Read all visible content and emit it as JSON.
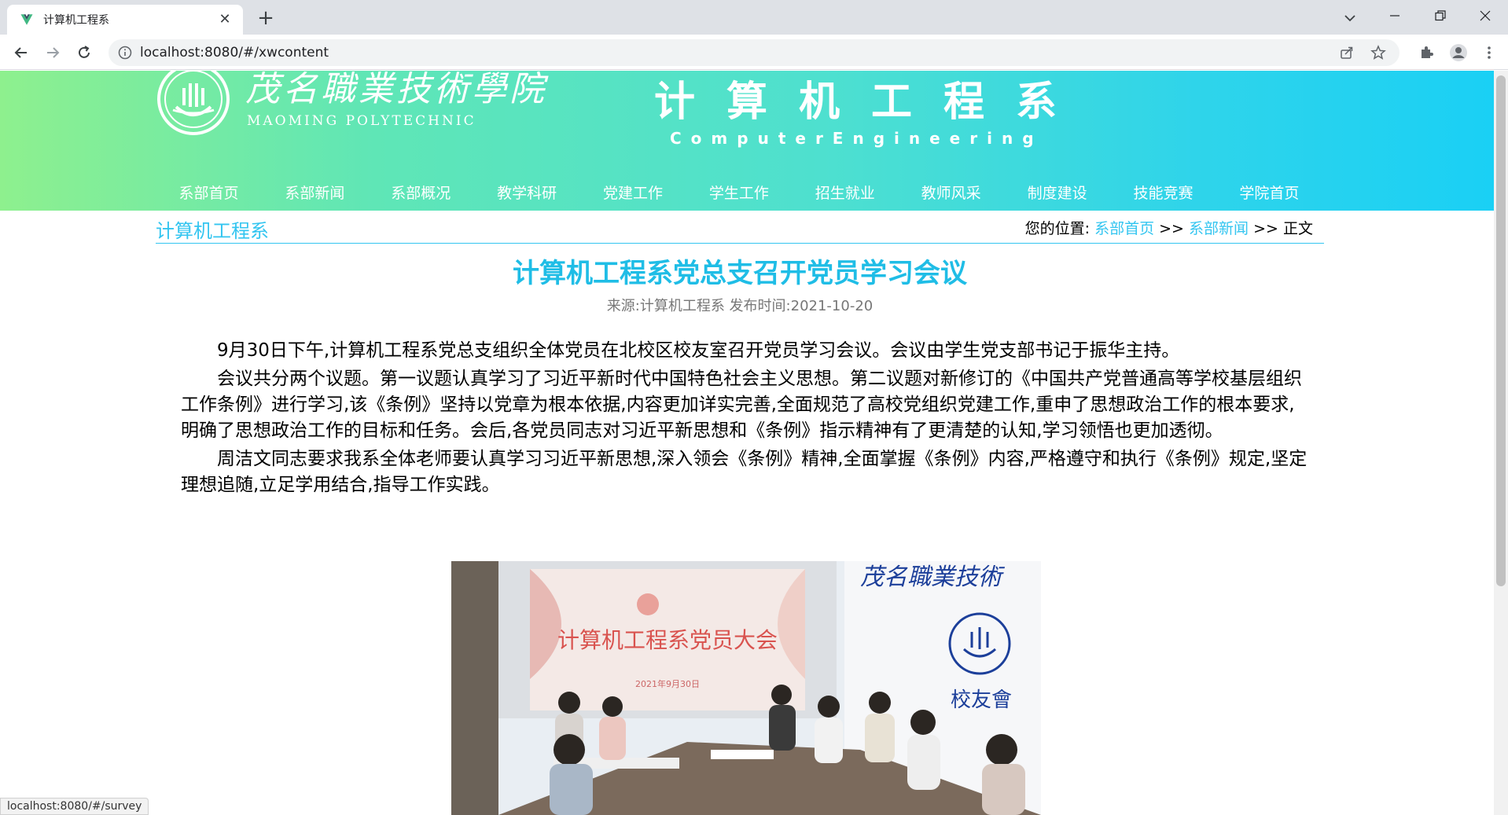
{
  "browser": {
    "tab_title": "计算机工程系",
    "url": "localhost:8080/#/xwcontent",
    "status_url": "localhost:8080/#/survey"
  },
  "header": {
    "school_name_cn": "茂名職業技術學院",
    "school_name_en": "MAOMING POLYTECHNIC",
    "dept_name_cn": "计算机工程系",
    "dept_name_en": "ComputerEngineering"
  },
  "nav": {
    "items": [
      "系部首页",
      "系部新闻",
      "系部概况",
      "教学科研",
      "党建工作",
      "学生工作",
      "招生就业",
      "教师风采",
      "制度建设",
      "技能竞赛",
      "学院首页"
    ]
  },
  "section": {
    "title": "计算机工程系",
    "breadcrumb_prefix": "您的位置:",
    "crumb_home": "系部首页",
    "crumb_sep1": ">>",
    "crumb_news": "系部新闻",
    "crumb_sep2": ">>",
    "crumb_current": "正文"
  },
  "article": {
    "title": "计算机工程系党总支召开党员学习会议",
    "meta": "来源:计算机工程系 发布时间:2021-10-20",
    "paragraphs": [
      "9月30日下午,计算机工程系党总支组织全体党员在北校区校友室召开党员学习会议。会议由学生党支部书记于振华主持。",
      "会议共分两个议题。第一议题认真学习了习近平新时代中国特色社会主义思想。第二议题对新修订的《中国共产党普通高等学校基层组织工作条例》进行学习,该《条例》坚持以党章为根本依据,内容更加详实完善,全面规范了高校党组织党建工作,重申了思想政治工作的根本要求,明确了思想政治工作的目标和任务。会后,各党员同志对习近平新思想和《条例》指示精神有了更清楚的认知,学习领悟也更加透彻。",
      "周洁文同志要求我系全体老师要认真学习习近平新思想,深入领会《条例》精神,全面掌握《条例》内容,严格遵守和执行《条例》规定,坚定理想追随,立足学用结合,指导工作实践。"
    ],
    "photo": {
      "screen_text": "计算机工程系党员大会",
      "screen_date": "2021年9月30日",
      "wall_text": "茂名職業技術",
      "wall_text2": "校友會"
    }
  },
  "colors": {
    "accent": "#33c5f0",
    "title": "#1fbde6",
    "banner_start": "#8ef08e",
    "banner_end": "#1ad0f5"
  }
}
